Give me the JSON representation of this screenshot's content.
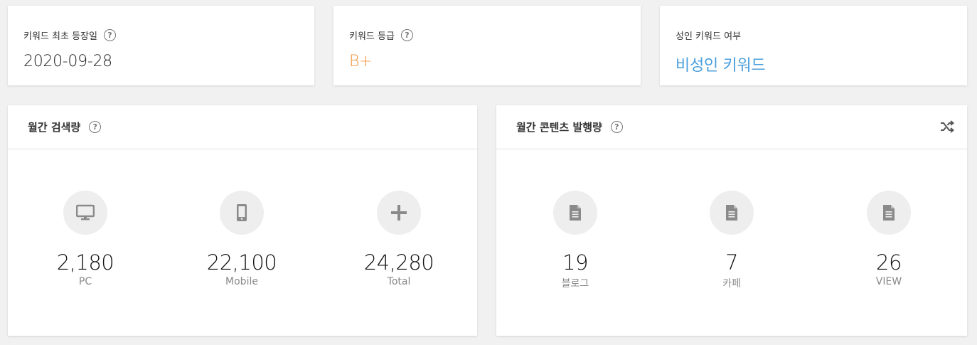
{
  "cards": {
    "first_date": {
      "label": "키워드 최초 등장일",
      "value": "2020-09-28"
    },
    "grade": {
      "label": "키워드 등급",
      "value": "B+"
    },
    "adult": {
      "label": "성인 키워드 여부",
      "value": "비성인 키워드"
    }
  },
  "search_volume": {
    "title": "월간 검색량",
    "pc": {
      "value": "2,180",
      "label": "PC",
      "icon": "monitor-icon"
    },
    "mobile": {
      "value": "22,100",
      "label": "Mobile",
      "icon": "smartphone-icon"
    },
    "total": {
      "value": "24,280",
      "label": "Total",
      "icon": "plus-icon"
    }
  },
  "content_volume": {
    "title": "월간 콘텐츠 발행량",
    "blog": {
      "value": "19",
      "label": "블로그",
      "icon": "document-icon"
    },
    "cafe": {
      "value": "7",
      "label": "카페",
      "icon": "document-icon"
    },
    "view": {
      "value": "26",
      "label": "VIEW",
      "icon": "document-icon"
    }
  },
  "colors": {
    "grade": "#f0953b",
    "adult": "#4a9fdd",
    "icon": "#8a8a8a"
  }
}
